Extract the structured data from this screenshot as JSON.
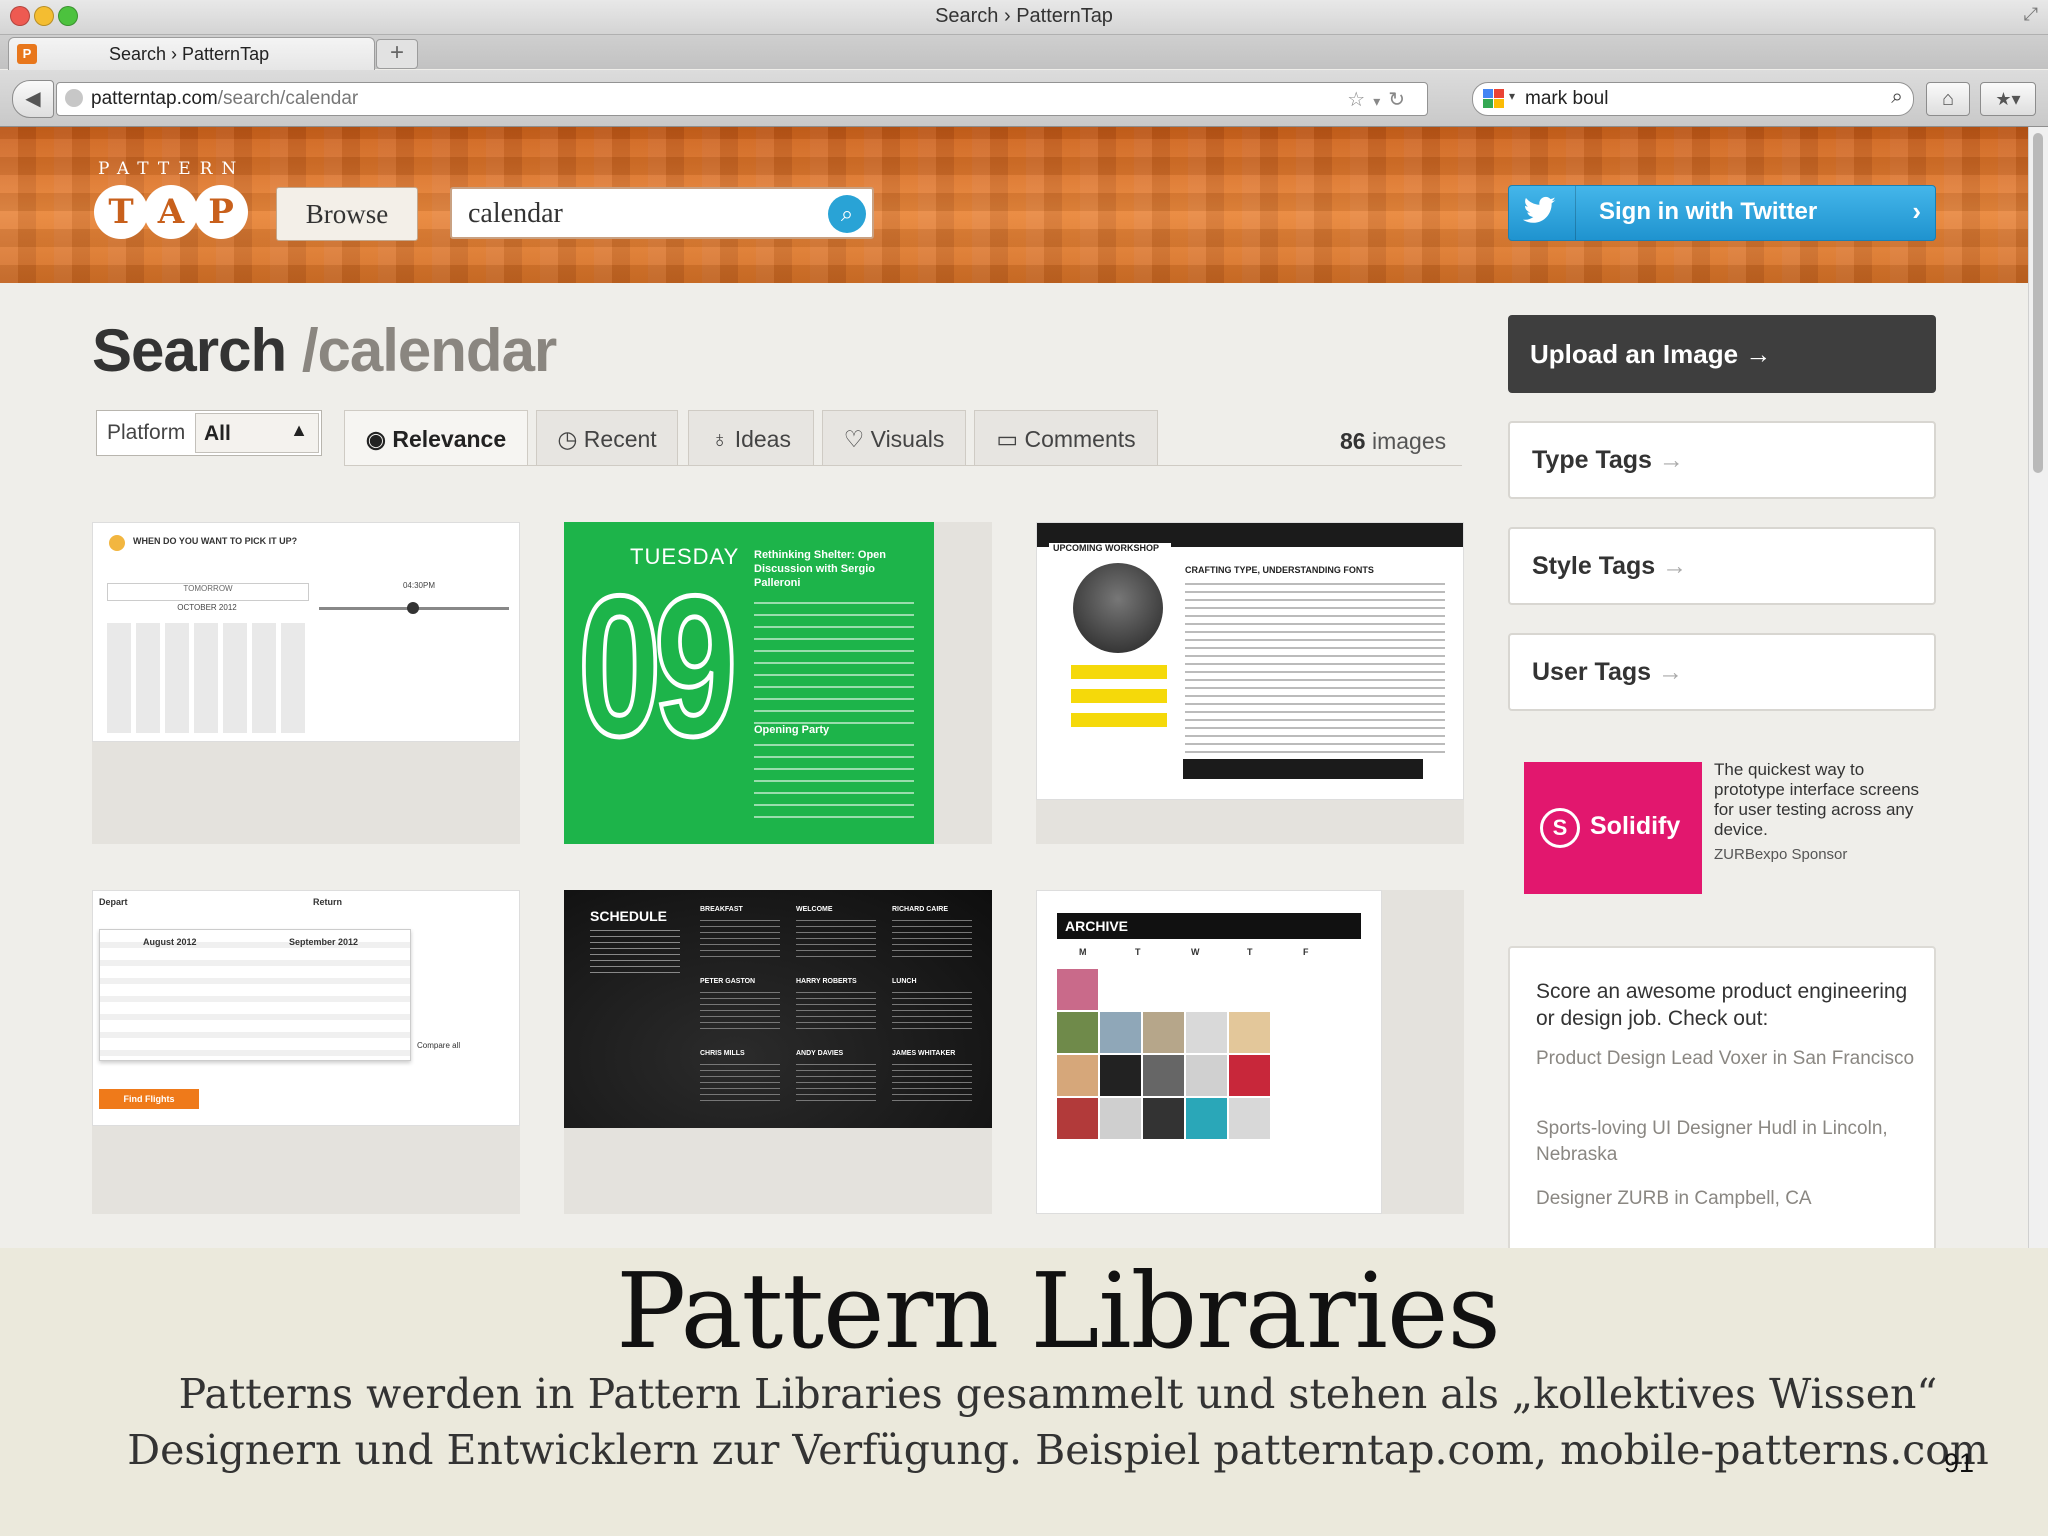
{
  "window": {
    "title": "Search › PatternTap"
  },
  "browser": {
    "tab_label": "Search › PatternTap",
    "url_host": "patterntap.com",
    "url_path": "/search/calendar",
    "search_value": "mark boul"
  },
  "site": {
    "logo_top": "PATTERN",
    "logo_letters": [
      "T",
      "A",
      "P"
    ],
    "browse_label": "Browse",
    "search_value": "calendar",
    "twitter_label": "Sign in with Twitter"
  },
  "main": {
    "heading_prefix": "Search",
    "heading_sep": "/",
    "heading_query": "calendar",
    "platform_label": "Platform",
    "platform_value": "All",
    "tabs": [
      "Relevance",
      "Recent",
      "Ideas",
      "Visuals",
      "Comments"
    ],
    "active_tab": "Relevance",
    "image_count": "86",
    "image_count_label": "images"
  },
  "thumbs": {
    "t1": {
      "q": "WHEN DO YOU WANT TO PICK IT UP?",
      "a": "TOMORROW",
      "b": "OCTOBER 2012",
      "time": "04:30PM"
    },
    "t2": {
      "day": "TUESDAY",
      "num": "09",
      "h1": "Rethinking Shelter: Open Discussion with Sergio Palleroni",
      "h2": "Opening Party"
    },
    "t3": {
      "banner": "UPCOMING WORKSHOP",
      "title": "CRAFTING TYPE, UNDERSTANDING FONTS"
    },
    "t4": {
      "depart": "Depart",
      "ret": "Return",
      "m1": "August 2012",
      "m2": "September 2012",
      "btn": "Find Flights",
      "compare": "Compare all"
    },
    "t5": {
      "title": "SCHEDULE",
      "items": [
        "BREAKFAST",
        "WELCOME",
        "RICHARD CAIRE",
        "PETER GASTON",
        "HARRY ROBERTS",
        "LUNCH",
        "CHRIS MILLS",
        "ANDY DAVIES",
        "JAMES WHITAKER"
      ]
    },
    "t6": {
      "title": "ARCHIVE",
      "days": [
        "M",
        "T",
        "W",
        "T",
        "F"
      ]
    }
  },
  "sidebar": {
    "upload_label": "Upload an Image",
    "tags": [
      "Type Tags",
      "Style Tags",
      "User Tags"
    ],
    "ad_name": "Solidify",
    "ad_copy": "The quickest way to prototype interface screens for user testing across any device.",
    "ad_sponsor": "ZURBexpo Sponsor",
    "jobs_title": "Score an awesome product engineering or design job. Check out:",
    "jobs": [
      "Product Design Lead Voxer in San Francisco",
      "Sports-loving UI Designer Hudl in Lincoln, Nebraska",
      "Designer ZURB in Campbell, CA"
    ]
  },
  "slide": {
    "title": "Pattern Libraries",
    "line1": "Patterns werden in Pattern Libraries gesammelt und stehen als „kollektives Wissen“",
    "line2": "Designern und Entwicklern zur Verfügung. Beispiel patterntap.com, mobile-patterns.com",
    "page": "91"
  },
  "colors": {
    "brand_orange": "#d4691f",
    "twitter_blue": "#29a3d6",
    "green": "#1db44a",
    "solidify_pink": "#e2176e"
  }
}
